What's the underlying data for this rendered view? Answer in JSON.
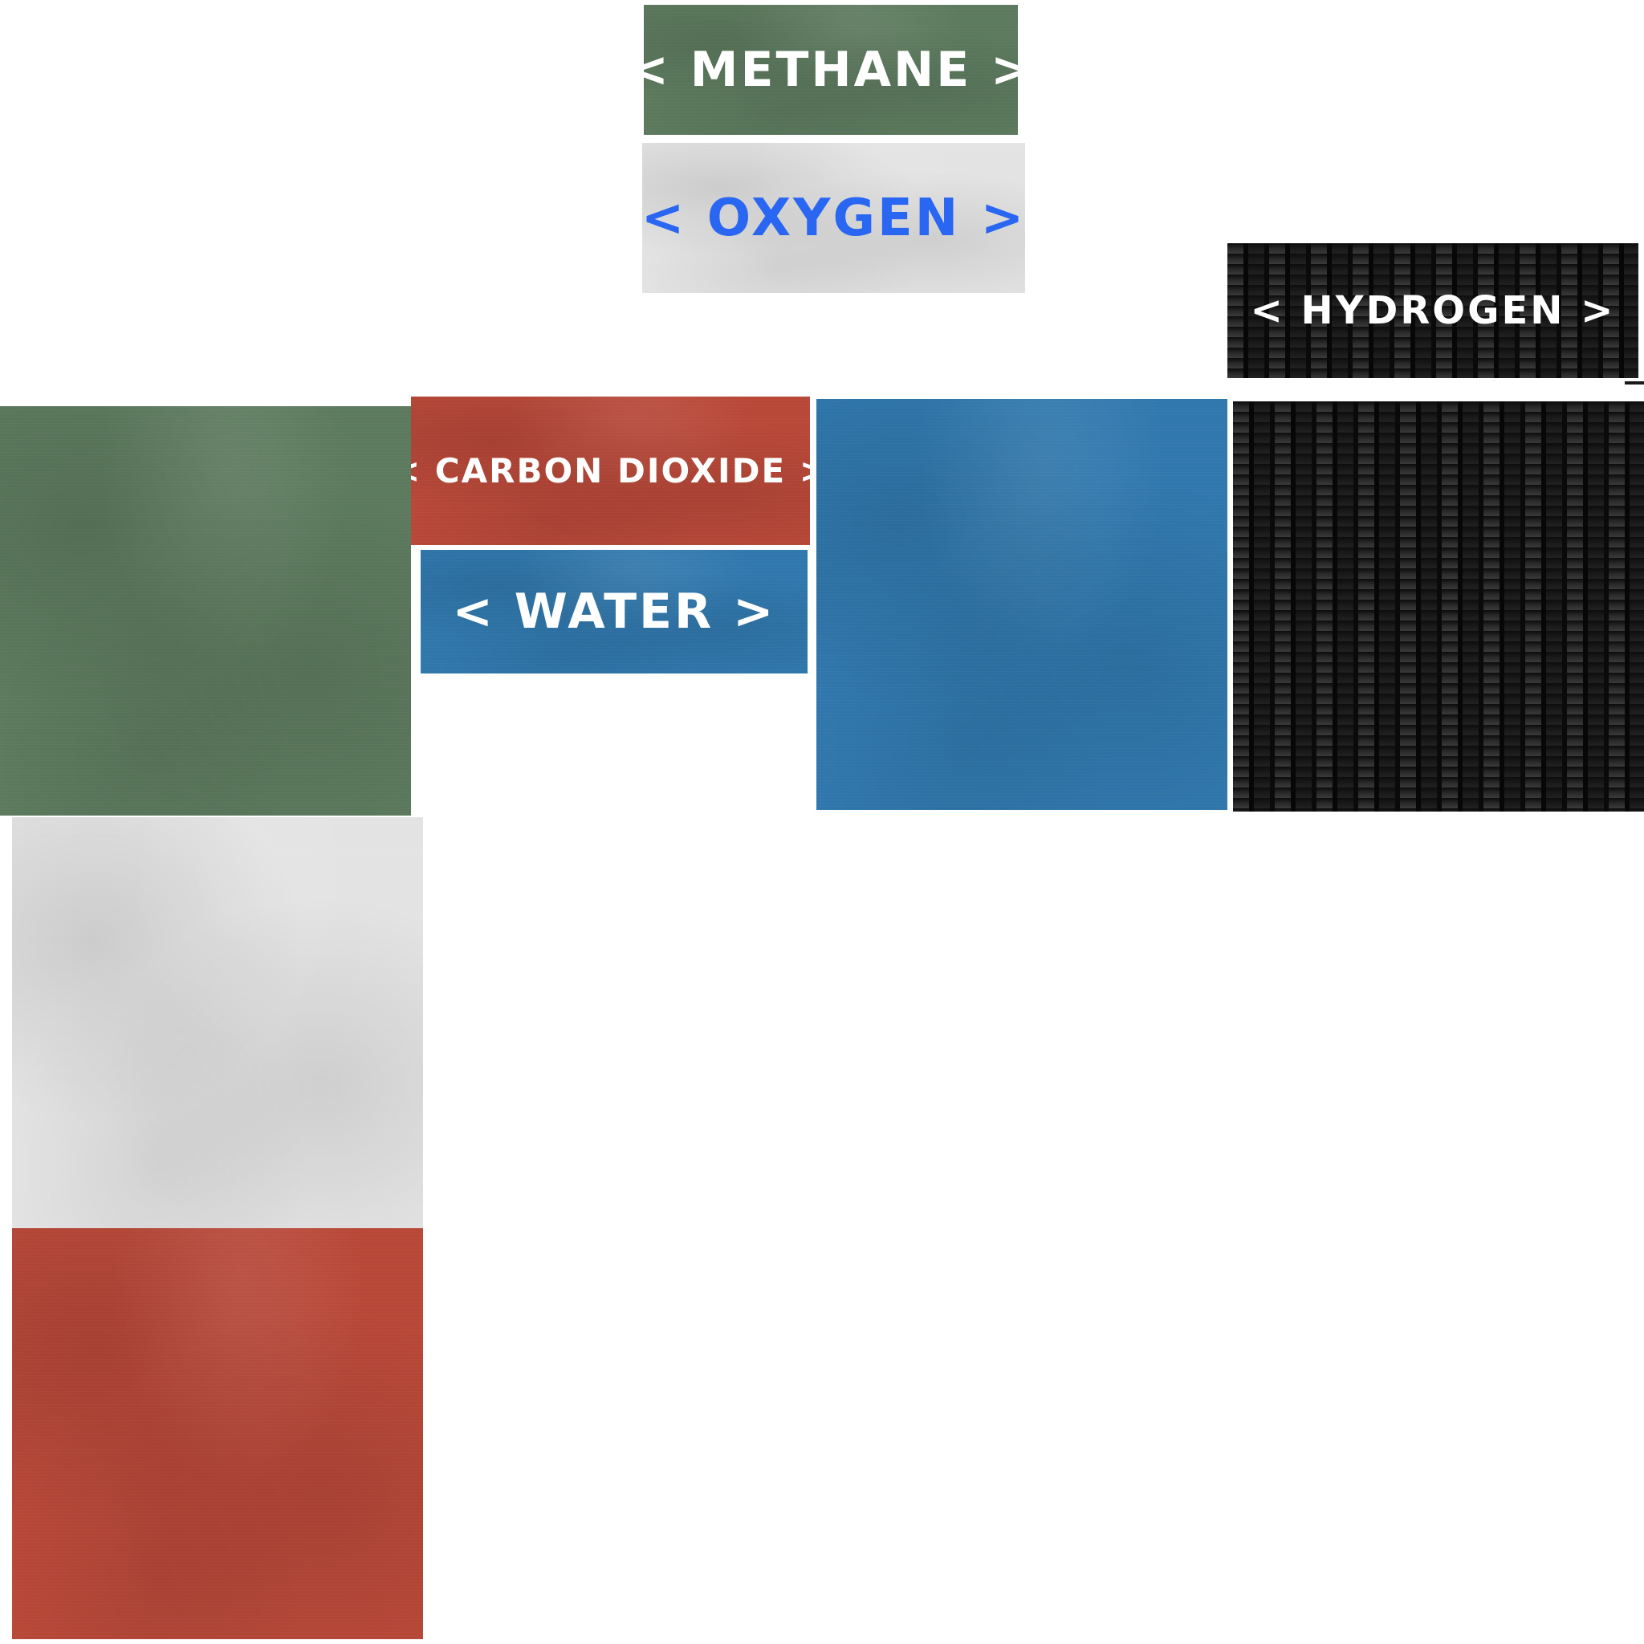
{
  "colors": {
    "green": "#5c7a5e",
    "white": "#e3e3e3",
    "red": "#b84838",
    "blue": "#3078ad",
    "carbon": "#111111",
    "label_white": "#ffffff",
    "label_blue": "#2966f2"
  },
  "labels": {
    "methane": "< METHANE >",
    "oxygen": "< OXYGEN >",
    "hydrogen": "< HYDROGEN >",
    "carbon_dioxide": "< CARBON DIOXIDE >",
    "water": "< WATER >"
  },
  "textures": [
    "green-painted-metal",
    "blue-painted-metal",
    "carbon-fiber",
    "white-painted-metal",
    "red-painted-metal"
  ]
}
